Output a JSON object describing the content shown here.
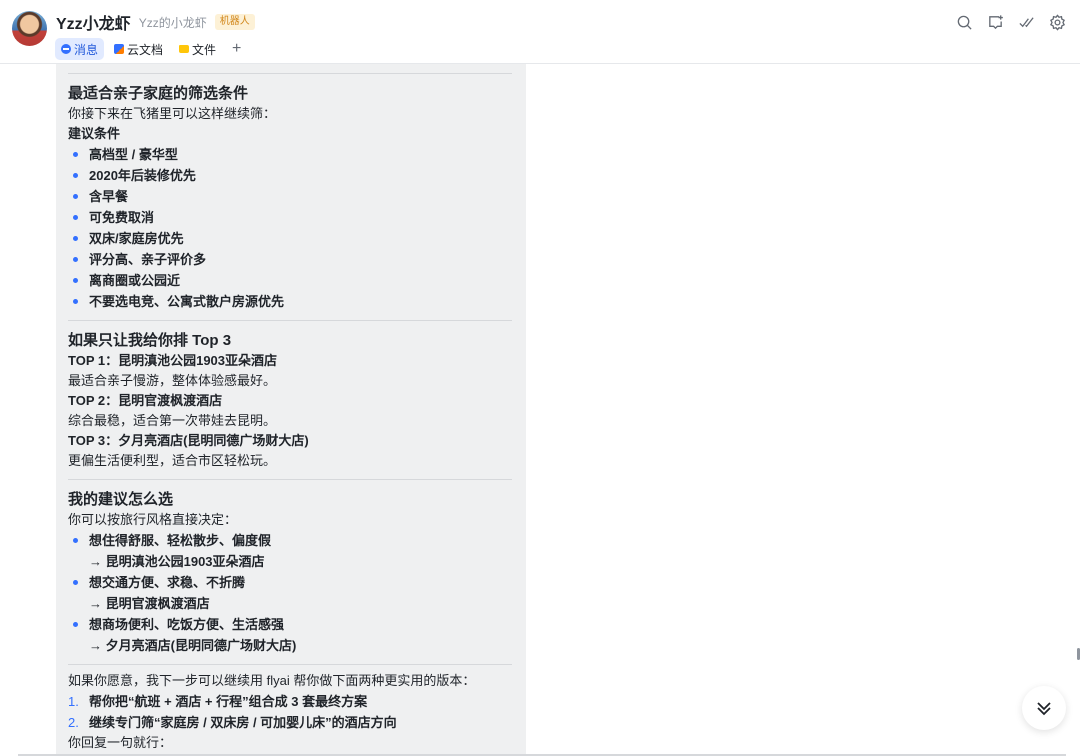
{
  "header": {
    "title": "Yzz小龙虾",
    "subtitle": "Yzz的小龙虾",
    "badge": "机器人",
    "tabs": [
      {
        "label": "消息",
        "icon": "message-icon",
        "active": true
      },
      {
        "label": "云文档",
        "icon": "doc-icon",
        "active": false
      },
      {
        "label": "文件",
        "icon": "folder-icon",
        "active": false
      }
    ],
    "add_tab": "+",
    "actions": [
      "search-icon",
      "add-chat-icon",
      "check-icon",
      "settings-icon"
    ]
  },
  "message": {
    "section1": {
      "heading": "最适合亲子家庭的筛选条件",
      "intro": "你接下来在飞猪里可以这样继续筛：",
      "subheading": "建议条件",
      "items": [
        "高档型 / 豪华型",
        "2020年后装修优先",
        "含早餐",
        "可免费取消",
        "双床/家庭房优先",
        "评分高、亲子评价多",
        "离商圈或公园近",
        "不要选电竞、公寓式散户房源优先"
      ]
    },
    "section2": {
      "heading": "如果只让我给你排 Top 3",
      "top1_title": "TOP 1：昆明滇池公园1903亚朵酒店",
      "top1_desc": "最适合亲子慢游，整体体验感最好。",
      "top2_title": "TOP 2：昆明官渡枫渡酒店",
      "top2_desc": "综合最稳，适合第一次带娃去昆明。",
      "top3_title": "TOP 3：夕月亮酒店(昆明同德广场财大店)",
      "top3_desc": "更偏生活便利型，适合市区轻松玩。"
    },
    "section3": {
      "heading": "我的建议怎么选",
      "intro": "你可以按旅行风格直接决定：",
      "choices": [
        {
          "label": "想住得舒服、轻松散步、偏度假",
          "pick": "→ 昆明滇池公园1903亚朵酒店"
        },
        {
          "label": "想交通方便、求稳、不折腾",
          "pick": "→ 昆明官渡枫渡酒店"
        },
        {
          "label": "想商场便利、吃饭方便、生活感强",
          "pick": "→ 夕月亮酒店(昆明同德广场财大店)"
        }
      ]
    },
    "section4": {
      "intro": "如果你愿意，我下一步可以继续用 flyai 帮你做下面两种更实用的版本：",
      "options": [
        {
          "num": "1.",
          "text": "帮你把“航班 + 酒店 + 行程”组合成 3 套最终方案"
        },
        {
          "num": "2.",
          "text": "继续专门筛“家庭房 / 双床房 / 可加婴儿床”的酒店方向"
        }
      ],
      "outro": "你回复一句就行："
    }
  },
  "scroll_to_bottom": "chevrons-down-icon"
}
